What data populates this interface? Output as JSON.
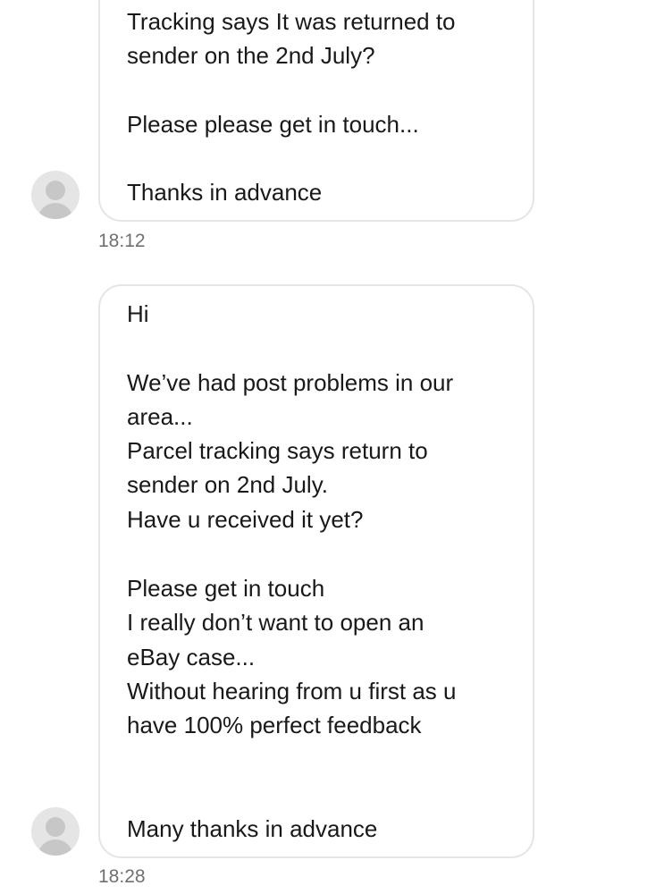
{
  "messages": [
    {
      "lines": [
        "Tracking says It was returned to",
        "sender on the 2nd July?",
        "",
        "Please please get in touch...",
        "",
        "Thanks in advance"
      ],
      "time": "18:12",
      "sender_avatar": "user-silhouette-icon"
    },
    {
      "lines": [
        "Hi",
        "",
        "We’ve had post problems in our",
        "area...",
        "Parcel tracking says return to",
        "sender on 2nd July.",
        "Have u received it yet?",
        "",
        "Please get in touch",
        "I really don’t want to open an",
        "eBay case...",
        "Without hearing from u first as u",
        "have 100% perfect feedback",
        "",
        "",
        "Many thanks in advance"
      ],
      "time": "18:28",
      "sender_avatar": "user-silhouette-icon"
    }
  ],
  "colors": {
    "bubble_border": "#e5e5e5",
    "avatar_bg": "#e5e5e5",
    "avatar_fg": "#c7c7c7",
    "text": "#191919",
    "timestamp": "#707070"
  }
}
